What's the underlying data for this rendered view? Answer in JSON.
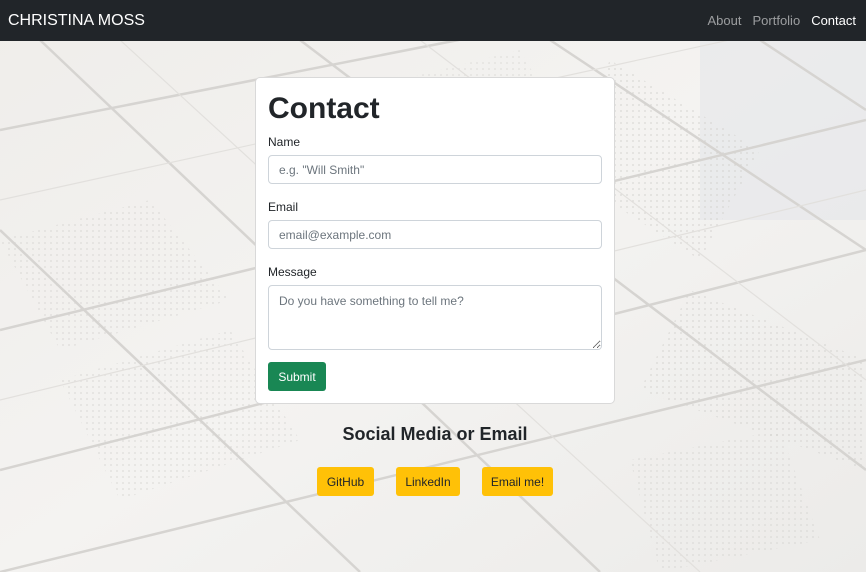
{
  "navbar": {
    "brand": "CHRISTINA MOSS",
    "links": [
      {
        "label": "About",
        "active": false
      },
      {
        "label": "Portfolio",
        "active": false
      },
      {
        "label": "Contact",
        "active": true
      }
    ]
  },
  "contact_form": {
    "title": "Contact",
    "name_label": "Name",
    "name_placeholder": "e.g. \"Will Smith\"",
    "email_label": "Email",
    "email_placeholder": "email@example.com",
    "message_label": "Message",
    "message_placeholder": "Do you have something to tell me?",
    "submit_label": "Submit"
  },
  "social": {
    "title": "Social Media or Email",
    "buttons": [
      {
        "label": "GitHub"
      },
      {
        "label": "LinkedIn"
      },
      {
        "label": "Email me!"
      }
    ]
  },
  "colors": {
    "navbar_bg": "#212529",
    "submit_bg": "#198754",
    "social_bg": "#ffc107"
  }
}
